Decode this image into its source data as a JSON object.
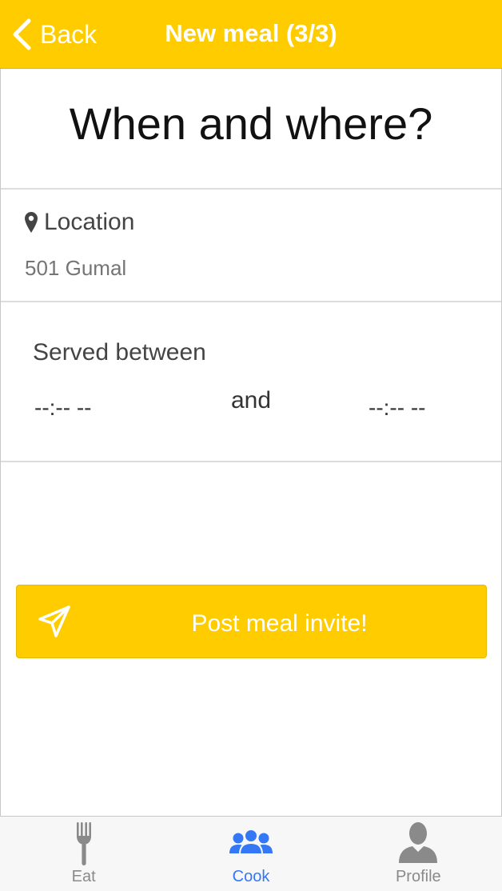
{
  "navbar": {
    "back_label": "Back",
    "title": "New meal (3/3)",
    "background_color": "#FFCC00"
  },
  "heading": "When and where?",
  "location": {
    "label": "Location",
    "icon": "map-marker-icon",
    "placeholder": "501 Gumal"
  },
  "time": {
    "label": "Served between",
    "start": "--:-- --",
    "conjunction": "and",
    "end": "--:-- --"
  },
  "post_button": {
    "label": "Post meal invite!",
    "icon": "paper-plane-icon"
  },
  "tabbar": {
    "tabs": [
      {
        "label": "Eat",
        "icon": "fork-icon",
        "active": false
      },
      {
        "label": "Cook",
        "icon": "people-group-icon",
        "active": true
      },
      {
        "label": "Profile",
        "icon": "person-icon",
        "active": false
      }
    ],
    "active_color": "#3478f6",
    "inactive_color": "#8a8a8a"
  }
}
